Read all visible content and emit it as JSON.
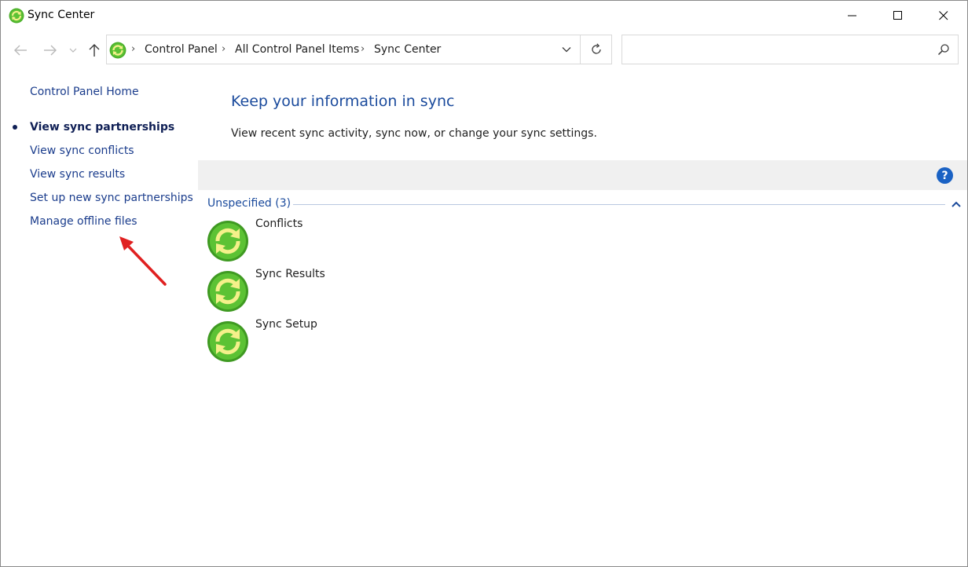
{
  "window": {
    "title": "Sync Center",
    "icon": "sync-center-icon",
    "controls": [
      "minimize",
      "maximize",
      "close"
    ]
  },
  "navigation": {
    "breadcrumbs": [
      "Control Panel",
      "All Control Panel Items",
      "Sync Center"
    ],
    "search_placeholder": ""
  },
  "sidebar": {
    "home_link": "Control Panel Home",
    "links": [
      {
        "label": "View sync partnerships",
        "active": true
      },
      {
        "label": "View sync conflicts",
        "active": false
      },
      {
        "label": "View sync results",
        "active": false
      },
      {
        "label": "Set up new sync partnerships",
        "active": false
      },
      {
        "label": "Manage offline files",
        "active": false
      }
    ]
  },
  "main": {
    "title": "Keep your information in sync",
    "description": "View recent sync activity, sync now, or change your sync settings.",
    "help_label": "?",
    "group": {
      "header": "Unspecified (3)",
      "items": [
        {
          "label": "Conflicts",
          "icon": "sync-icon"
        },
        {
          "label": "Sync Results",
          "icon": "sync-icon"
        },
        {
          "label": "Sync Setup",
          "icon": "sync-icon"
        }
      ]
    }
  },
  "colors": {
    "link": "#1a3c8c",
    "heading": "#1a4a9c",
    "sync_green": "#4caf2a",
    "sync_arrow": "#f4f08a",
    "annotation_arrow": "#e02020"
  }
}
